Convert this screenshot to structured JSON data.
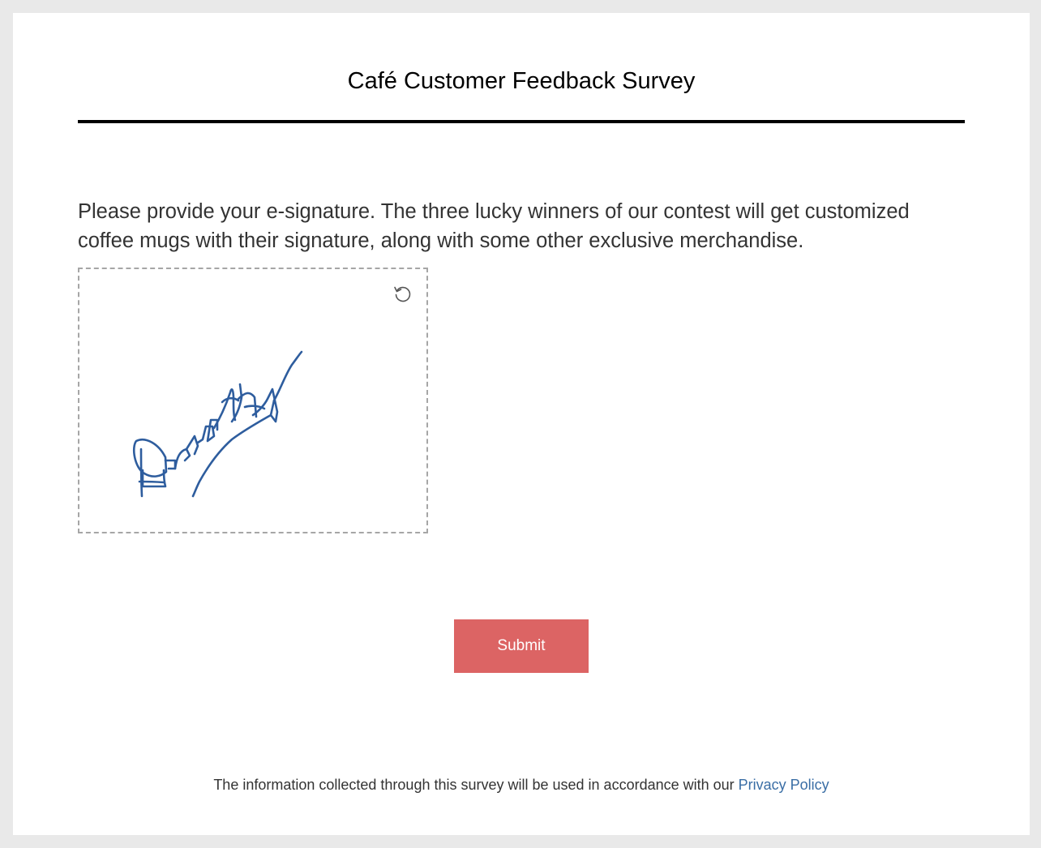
{
  "survey": {
    "title": "Café Customer Feedback Survey"
  },
  "question": {
    "text": "Please provide your e-signature. The three lucky winners of our contest will get customized coffee mugs with their signature, along with some other exclusive merchandise."
  },
  "signature_pad": {
    "reset_icon": "rotate-ccw-icon",
    "stroke_color": "#2e5d9e",
    "border_color": "#a6a6a6"
  },
  "submit": {
    "label": "Submit",
    "color": "#dc6464"
  },
  "footer": {
    "text": "The information collected through this survey will be used in accordance with our ",
    "link_label": "Privacy Policy",
    "link_color": "#3a6ea5"
  }
}
